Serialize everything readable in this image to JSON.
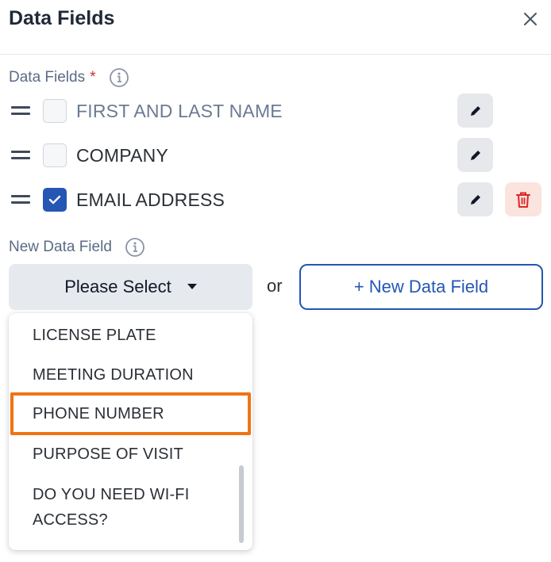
{
  "header": {
    "title": "Data Fields"
  },
  "data_fields_section": {
    "label": "Data Fields",
    "required_marker": "*",
    "fields": [
      {
        "label": "FIRST AND LAST NAME",
        "checked": false
      },
      {
        "label": "COMPANY",
        "checked": false
      },
      {
        "label": "EMAIL ADDRESS",
        "checked": true
      }
    ]
  },
  "new_field_section": {
    "label": "New Data Field",
    "select_placeholder": "Please Select",
    "or_text": "or",
    "new_button_label": "+ New Data Field",
    "dropdown_options": [
      "LICENSE PLATE",
      "MEETING DURATION",
      "PHONE NUMBER",
      "PURPOSE OF VISIT",
      "DO YOU NEED WI-FI ACCESS?"
    ],
    "highlighted_option": "PHONE NUMBER"
  },
  "colors": {
    "accent": "#2556b3",
    "required": "#dc2626",
    "highlight": "#ef7414",
    "delete_bg": "#fbe3de"
  }
}
